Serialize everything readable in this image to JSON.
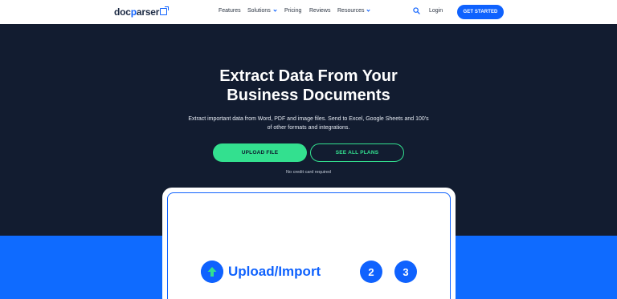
{
  "header": {
    "logo": {
      "prefix": "doc",
      "accent": "p",
      "suffix": "arser"
    },
    "nav": [
      {
        "label": "Features",
        "has_dropdown": false
      },
      {
        "label": "Solutions",
        "has_dropdown": true
      },
      {
        "label": "Pricing",
        "has_dropdown": false
      },
      {
        "label": "Reviews",
        "has_dropdown": false
      },
      {
        "label": "Resources",
        "has_dropdown": true
      }
    ],
    "search_icon": "search-icon",
    "login": "Login",
    "cta": "GET STARTED"
  },
  "hero": {
    "headline_line1": "Extract Data From Your",
    "headline_line2": "Business Documents",
    "subtext_line1": "Extract important data from Word, PDF and image files. Send to Excel, Google Sheets and 100's",
    "subtext_line2": "of other formats and integrations.",
    "upload_button": "UPLOAD FILE",
    "plans_button": "SEE ALL PLANS",
    "no_credit_card": "No credit card required"
  },
  "card": {
    "step1_label": "Upload/Import",
    "step1_icon": "upload-arrow-icon",
    "step2": "2",
    "step3": "3"
  },
  "colors": {
    "brand_blue": "#0f62fe",
    "hero_bg": "#121c30",
    "accent_green": "#33e08f",
    "band_blue": "#0f6bff"
  }
}
